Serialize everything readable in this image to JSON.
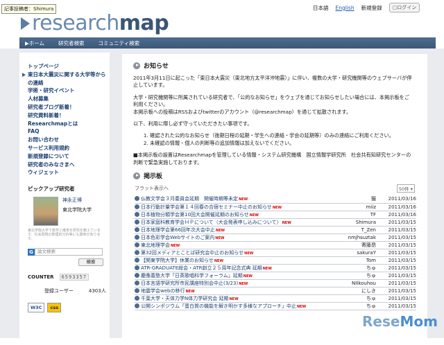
{
  "tooltip": "記事投稿者：Shimura",
  "logo": {
    "a": "research",
    "b": "map"
  },
  "header": {
    "lang_ja": "日本語",
    "lang_en": "English",
    "register": "新規登録",
    "login": "ログイン"
  },
  "nav": {
    "home": "▶ホーム",
    "search": "研究者検索",
    "community": "コミュニティ検索"
  },
  "sidebar": {
    "menu": [
      "トップページ",
      "東日本大震災に関する大学等からの連絡",
      "学術・研究イベント",
      "人材募集",
      "研究者ブログ新着！",
      "研究資料新着！",
      "Researchmapとは",
      "FAQ",
      "お問い合わせ",
      "サービス利用規約",
      "新規登録について",
      "研究者のみなさまへ",
      "ウィジェット"
    ],
    "pickup_title": "ピックアップ研究者",
    "pickup_name": "神永正博",
    "pickup_org": "東北学院大学",
    "pickup_desc": "東北学院大学で数学と確率を研究を教えています。社会問題の数理的分析等にも興味があります。",
    "search_placeholder": "論文検索",
    "search_button": "検索",
    "counter_label": "COUNTER",
    "counter_value": "6593357",
    "users_label": "登録ユーザー",
    "users_value": "4303人",
    "badge_w3c": "W3C",
    "badge_css": "css"
  },
  "main": {
    "notice_title": "お知らせ",
    "p1": "2011年3月11日に起こった「東日本大震災（東北地方太平洋沖地震）」に伴い、複数の大学・研究機関等のウェブサーバが停止しています。",
    "p2": "大学・研究機関等に所属されている研究者で、「公的なお知らせ」をウェブを通じてお知らせしたい場合には、本掲示板をご利用ください。",
    "p3": "本掲示板への投稿はRSSおよびtwitterのアカウント（@researchmap）を通じて拡散されます。",
    "p4": "以下、利用に際し必ず守っていただきたい事項です。",
    "li1": "確認された公的なお知らせ（後期日程の延期・学生への連絡・学会の延期等）のみの連絡にご利用ください。",
    "li2": "未確認の情報・個人の判断等の追加情報は加えないでください。",
    "p5": "■本掲示板の設置はResearchmapを管理している情報・システム研究機構　国立情報学研究所　社会共有知研究センターの判断で緊急実施しております。",
    "board_title": "掲示板",
    "flat_view": "フラット表示へ",
    "count_select": "50件",
    "posts": [
      {
        "title": "仏教文学会３月委員会延期　開催時期等未定",
        "author": "猫",
        "date": "2011/03/16"
      },
      {
        "title": "日本行動計量学会第１４回春の合宿セミナー中止のお知らせ",
        "author": "miiz",
        "date": "2011/03/16"
      },
      {
        "title": "日本植物分類学会第10回大会開催延期のお知らせ",
        "author": "TF",
        "date": "2011/03/16"
      },
      {
        "title": "日本家庭科教育学会ＨＰについて（大会発表申し込みについて）",
        "author": "Shimura",
        "date": "2011/03/15"
      },
      {
        "title": "日本地理学会第66回年次大会中止",
        "author": "T_Zen",
        "date": "2011/03/15"
      },
      {
        "title": "日本色彩学会Webサイトのご案内",
        "author": "nmjhsuztak",
        "date": "2011/03/15"
      },
      {
        "title": "東北地理学会",
        "author": "寄藤昂",
        "date": "2011/03/15"
      },
      {
        "title": "第32回メディアとことば研究会中止のお知らせ",
        "author": "sakuraY",
        "date": "2011/03/15"
      },
      {
        "title": "【関東学院大学】休業のお知らせ",
        "author": "Tom",
        "date": "2011/03/15"
      },
      {
        "title": "ATR-GRADUATE総会・ATR創立２５周年記念式典 延期",
        "author": "ちゅ",
        "date": "2011/03/15"
      },
      {
        "title": "慶應義塾大学「日英歌唱科学フォーラム」延期",
        "author": "ちゅ",
        "date": "2011/03/15"
      },
      {
        "title": "日本言語学研究所市民講座特別会中止(3/23)",
        "author": "NIIkouhou",
        "date": "2011/03/15"
      },
      {
        "title": "地震学会webの移行",
        "author": "にしき",
        "date": "2011/03/15"
      },
      {
        "title": "千葉大学・天体力学N体力学研究会 延期",
        "author": "ちゅ",
        "date": "2011/03/15"
      },
      {
        "title": "公開シンポジウム「蛋白質の機能を解き明かす多様なアプローチ」中止",
        "author": "ちゅ",
        "date": "2011/03/15"
      }
    ],
    "new_badge": "NEW"
  },
  "watermark": {
    "a": "Rese",
    "b": "Mom"
  }
}
